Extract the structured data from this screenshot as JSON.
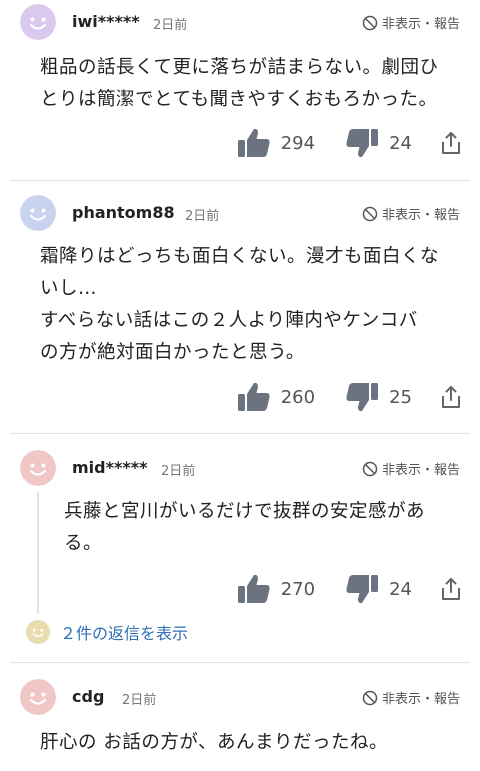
{
  "comments": [
    {
      "user": "iwi*****",
      "time": "2日前",
      "hide_label": "非表示・報告",
      "text": "粗品の話長くて更に落ちが詰まらない。劇団ひ\nとりは簡潔でとても聞きやすくおもろかった。",
      "likes": "294",
      "dislikes": "24",
      "avatar_color": "#d9c9ef"
    },
    {
      "user": "phantom88",
      "time": "2日前",
      "hide_label": "非表示・報告",
      "text": "霜降りはどっちも面白くない。漫才も面白くな\nいし…\nすべらない話はこの２人より陣内やケンコバ\nの方が絶対面白かったと思う。",
      "likes": "260",
      "dislikes": "25",
      "avatar_color": "#c9d3ef"
    },
    {
      "user": "mid*****",
      "time": "2日前",
      "hide_label": "非表示・報告",
      "text": "兵藤と宮川がいるだけで抜群の安定感があ\nる。",
      "likes": "270",
      "dislikes": "24",
      "avatar_color": "#f1c6c6",
      "replies_label": "２件の返信を表示"
    },
    {
      "user": "cdg",
      "time": "2日前",
      "hide_label": "非表示・報告",
      "text": "肝心の お話の方が、あんまりだったね。",
      "avatar_color": "#f1c6c6"
    }
  ],
  "icons": {
    "like": "thumbs-up-icon",
    "dislike": "thumbs-down-icon",
    "share": "share-icon",
    "hide": "block-icon"
  }
}
